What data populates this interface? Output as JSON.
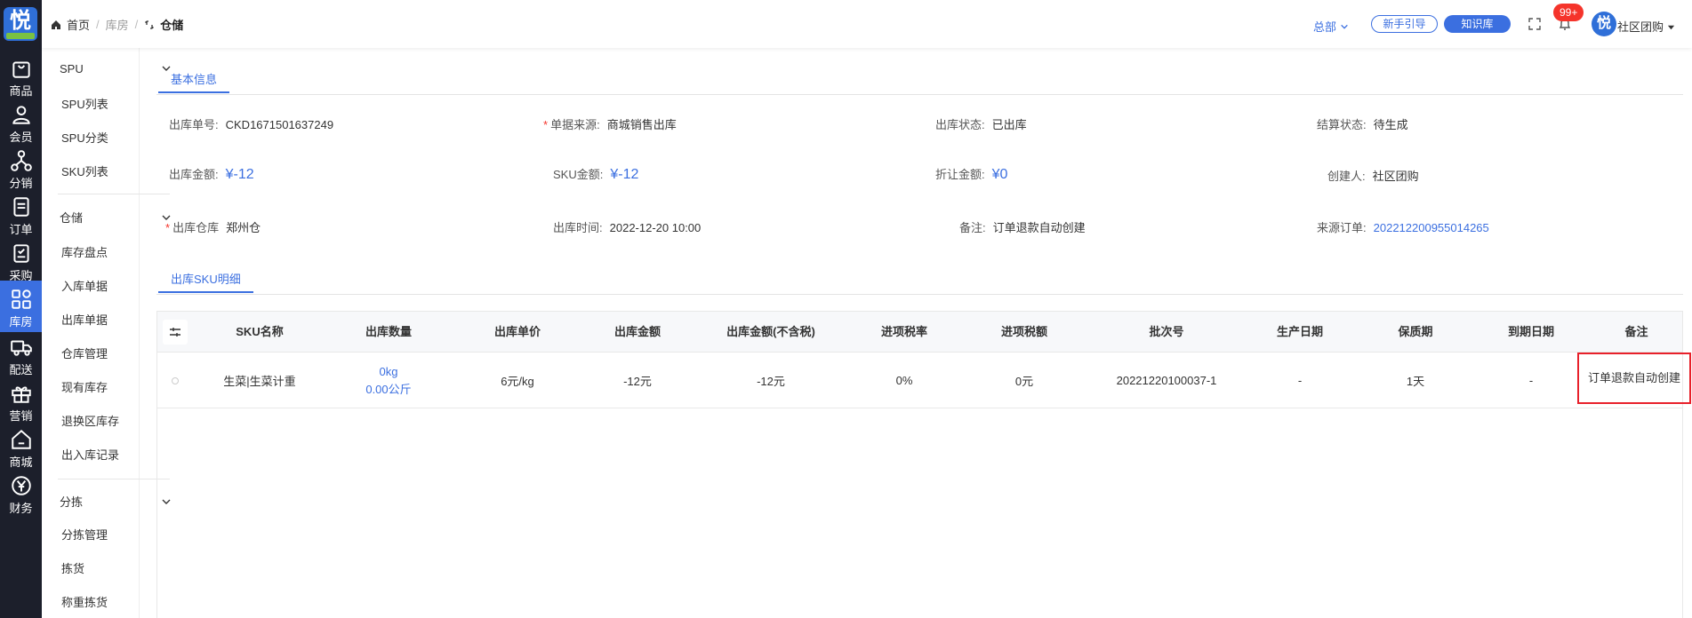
{
  "app": {
    "logo_char": "悦"
  },
  "rail": [
    {
      "label": "商品",
      "icon": "bag-icon"
    },
    {
      "label": "会员",
      "icon": "user-icon"
    },
    {
      "label": "分销",
      "icon": "network-icon"
    },
    {
      "label": "订单",
      "icon": "document-icon"
    },
    {
      "label": "采购",
      "icon": "clipboard-icon"
    },
    {
      "label": "库房",
      "icon": "grid-icon"
    },
    {
      "label": "配送",
      "icon": "truck-icon"
    },
    {
      "label": "营销",
      "icon": "gift-icon"
    },
    {
      "label": "商城",
      "icon": "home-icon"
    },
    {
      "label": "财务",
      "icon": "yen-icon"
    }
  ],
  "subnav": {
    "groups": [
      {
        "label": "SPU",
        "items": [
          "SPU列表",
          "SPU分类",
          "SKU列表"
        ]
      },
      {
        "label": "仓储",
        "items": [
          "库存盘点",
          "入库单据",
          "出库单据",
          "仓库管理",
          "现有库存",
          "退换区库存",
          "出入库记录"
        ]
      },
      {
        "label": "分拣",
        "items": [
          "分拣管理",
          "拣货",
          "称重拣货"
        ]
      }
    ]
  },
  "header": {
    "breadcrumb": [
      "首页",
      "库房",
      "仓储"
    ],
    "org": "总部",
    "guide_btn": "新手引导",
    "kb_btn": "知识库",
    "notif_count": "99+",
    "avatar_char": "悦",
    "user": "社区团购"
  },
  "basic_tab": "基本信息",
  "fields": {
    "out_no": {
      "label": "出库单号:",
      "value": "CKD1671501637249"
    },
    "source": {
      "label": "单据来源:",
      "value": "商城销售出库"
    },
    "status": {
      "label": "出库状态:",
      "value": "已出库"
    },
    "settle": {
      "label": "结算状态:",
      "value": "待生成"
    },
    "amount": {
      "label": "出库金额:",
      "value": "¥-12"
    },
    "sku_amount": {
      "label": "SKU金额:",
      "value": "¥-12"
    },
    "discount": {
      "label": "折让金额:",
      "value": "¥0"
    },
    "creator": {
      "label": "创建人:",
      "value": "社区团购"
    },
    "warehouse": {
      "label": "出库仓库",
      "value": "郑州仓"
    },
    "time": {
      "label": "出库时间:",
      "value": "2022-12-20 10:00"
    },
    "remark": {
      "label": "备注:",
      "value": "订单退款自动创建"
    },
    "source_order": {
      "label": "来源订单:",
      "value": "202212200955014265"
    }
  },
  "detail_tab": "出库SKU明细",
  "table": {
    "headers": [
      "SKU名称",
      "出库数量",
      "出库单价",
      "出库金额",
      "出库金额(不含税)",
      "进项税率",
      "进项税额",
      "批次号",
      "生产日期",
      "保质期",
      "到期日期",
      "备注"
    ],
    "row": {
      "name": "生菜|生菜计重",
      "qty_a": "0kg",
      "qty_b": "0.00公斤",
      "price": "6元/kg",
      "amount": "-12元",
      "amount_ex": "-12元",
      "tax_rate": "0%",
      "tax_amt": "0元",
      "batch": "20221220100037-1",
      "prod_date": "-",
      "shelf_life": "1天",
      "expiry": "-",
      "remark": "订单退款自动创建"
    }
  }
}
